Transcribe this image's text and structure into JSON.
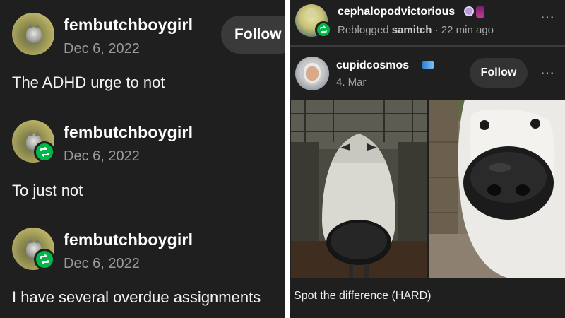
{
  "left_feed": {
    "posts": [
      {
        "username": "fembutchboygirl",
        "date": "Dec 6, 2022",
        "text": "The ADHD urge to not",
        "follow_label": "Follow"
      },
      {
        "username": "fembutchboygirl",
        "date": "Dec 6, 2022",
        "text": "To just not"
      },
      {
        "username": "fembutchboygirl",
        "date": "Dec 6, 2022",
        "text": "I have several overdue assignments"
      }
    ]
  },
  "right_feed": {
    "reblogger": {
      "username": "cephalopodvictorious",
      "reblog_prefix": "Reblogged",
      "reblogged_from": "samitch",
      "time_ago": "22 min ago"
    },
    "author": {
      "username": "cupidcosmos",
      "date": "4. Mar",
      "follow_label": "Follow"
    },
    "caption": "Spot the difference (HARD)",
    "more_icon": "⋯"
  },
  "colors": {
    "background": "#1f1f1f",
    "reblog_green": "#00b84a",
    "muted_text": "#9a9a9a"
  }
}
